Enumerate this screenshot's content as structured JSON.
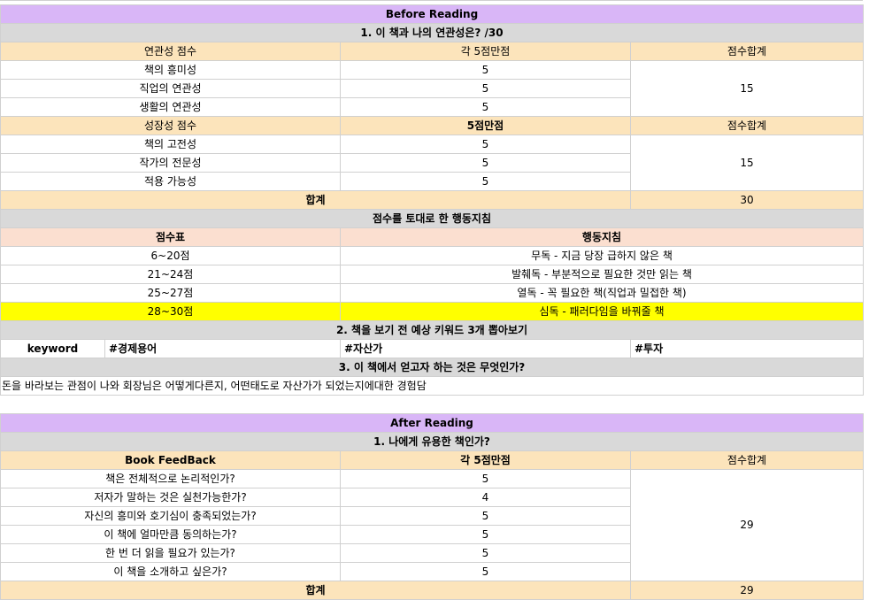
{
  "before": {
    "title": "Before Reading",
    "q1": {
      "title": "1. 이 책과 나의 연관성은? /30",
      "relevance": {
        "header": [
          "연관성 점수",
          "각 5점만점",
          "점수합계"
        ],
        "rows": [
          {
            "label": "책의 흥미성",
            "score": "5"
          },
          {
            "label": "직업의 연관성",
            "score": "5"
          },
          {
            "label": "생활의 연관성",
            "score": "5"
          }
        ],
        "total": "15"
      },
      "growth": {
        "header": [
          "성장성 점수",
          "5점만점",
          "점수합계"
        ],
        "rows": [
          {
            "label": "책의 고전성",
            "score": "5"
          },
          {
            "label": "작가의 전문성",
            "score": "5"
          },
          {
            "label": "적용 가능성",
            "score": "5"
          }
        ],
        "total": "15"
      },
      "sum_label": "합계",
      "sum_value": "30"
    },
    "guide": {
      "title": "점수를 토대로 한 행동지침",
      "header": [
        "점수표",
        "행동지침"
      ],
      "rows": [
        {
          "range": "6~20점",
          "action": "무독   - 지금 당장 급하지 않은 책"
        },
        {
          "range": "21~24점",
          "action": "발췌독 - 부분적으로 필요한 것만 읽는 책"
        },
        {
          "range": "25~27점",
          "action": "열독   - 꼭 필요한 책(직업과 밀접한 책)"
        },
        {
          "range": "28~30점",
          "action": "심독   - 패러다임을 바꿔줄 책"
        }
      ]
    },
    "q2": {
      "title": "2. 책을 보기 전 예상 키워드 3개 뽑아보기",
      "label": "keyword",
      "keywords": [
        "#경제용어",
        "#자산가",
        "#투자"
      ]
    },
    "q3": {
      "title": "3. 이 책에서 얻고자 하는 것은 무엇인가?",
      "answer": "돈을 바라보는 관점이 나와 회장님은 어떻게다른지, 어떤태도로 자산가가 되었는지에대한 경험담"
    }
  },
  "after": {
    "title": "After Reading",
    "q1": {
      "title": "1. 나에게 유용한 책인가?",
      "header": [
        "Book FeedBack",
        "각 5점만점",
        "점수합계"
      ],
      "rows": [
        {
          "label": "책은 전체적으로 논리적인가?",
          "score": "5"
        },
        {
          "label": "저자가 말하는 것은 실천가능한가?",
          "score": "4"
        },
        {
          "label": "자신의 흥미와 호기심이 충족되었는가?",
          "score": "5"
        },
        {
          "label": "이 책에 얼마만큼 동의하는가?",
          "score": "5"
        },
        {
          "label": "한 번 더 읽을 필요가 있는가?",
          "score": "5"
        },
        {
          "label": "이 책을 소개하고 싶은가?",
          "score": "5"
        }
      ],
      "total": "29",
      "sum_label": "합계",
      "sum_value": "29"
    }
  }
}
